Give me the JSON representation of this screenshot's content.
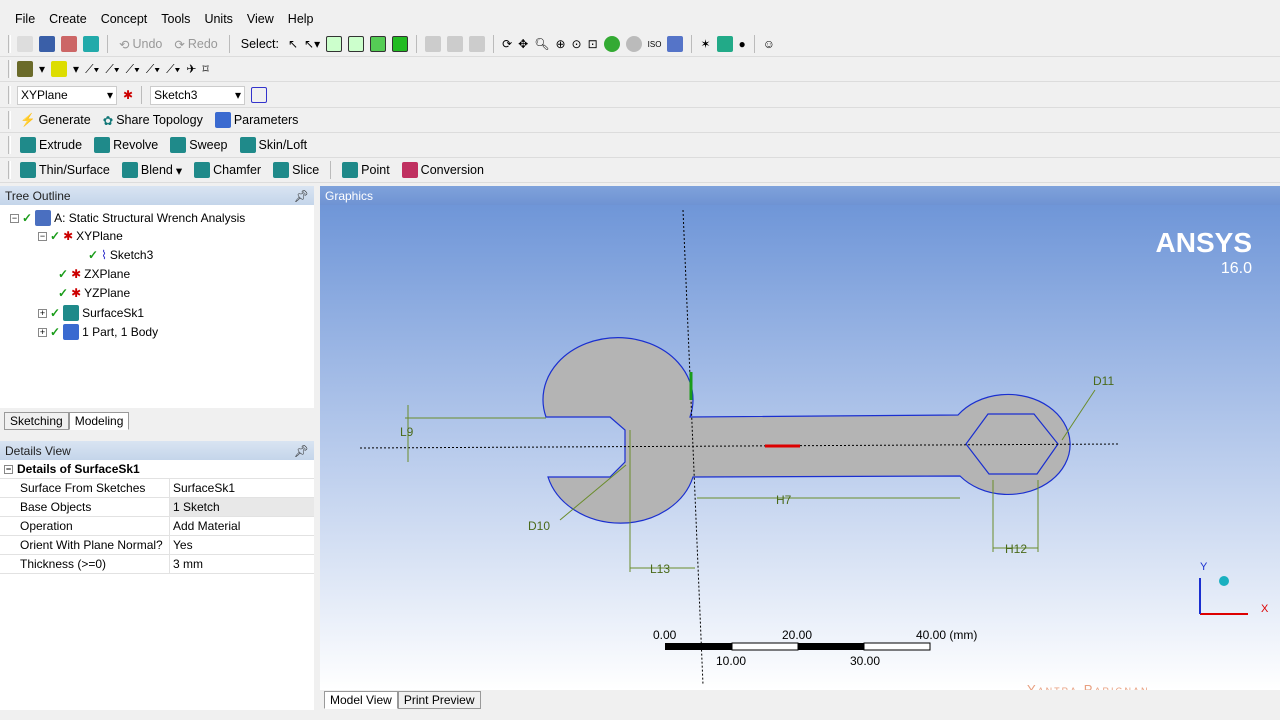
{
  "menu": [
    "File",
    "Create",
    "Concept",
    "Tools",
    "Units",
    "View",
    "Help"
  ],
  "toolbar1": {
    "undo": "Undo",
    "redo": "Redo",
    "select": "Select:"
  },
  "toolbar3": {
    "plane": "XYPlane",
    "sketch": "Sketch3"
  },
  "toolbar4": [
    "Generate",
    "Share Topology",
    "Parameters"
  ],
  "toolbar5": [
    "Extrude",
    "Revolve",
    "Sweep",
    "Skin/Loft"
  ],
  "toolbar6": [
    "Thin/Surface",
    "Blend",
    "Chamfer",
    "Slice",
    "Point",
    "Conversion"
  ],
  "tree": {
    "title": "Tree Outline",
    "items": [
      "A: Static Structural Wrench Analysis",
      "XYPlane",
      "Sketch3",
      "ZXPlane",
      "YZPlane",
      "SurfaceSk1",
      "1 Part, 1 Body"
    ],
    "tabs": [
      "Sketching",
      "Modeling"
    ]
  },
  "details": {
    "title": "Details View",
    "header": "Details of SurfaceSk1",
    "rows": [
      [
        "Surface From Sketches",
        "SurfaceSk1"
      ],
      [
        "Base Objects",
        "1 Sketch"
      ],
      [
        "Operation",
        "Add Material"
      ],
      [
        "Orient With Plane Normal?",
        "Yes"
      ],
      [
        "Thickness (>=0)",
        "3 mm"
      ]
    ]
  },
  "graphics": {
    "title": "Graphics",
    "logo": "ANSYS",
    "version": "16.0",
    "dims": [
      "L9",
      "D10",
      "D11",
      "H7",
      "H12",
      "L13"
    ],
    "scale_top": [
      "0.00",
      "20.00",
      "40.00 (mm)"
    ],
    "scale_bottom": [
      "10.00",
      "30.00"
    ],
    "axes": [
      "X",
      "Y"
    ],
    "watermark": "Yantra Parignan",
    "tabs": [
      "Model View",
      "Print Preview"
    ]
  }
}
